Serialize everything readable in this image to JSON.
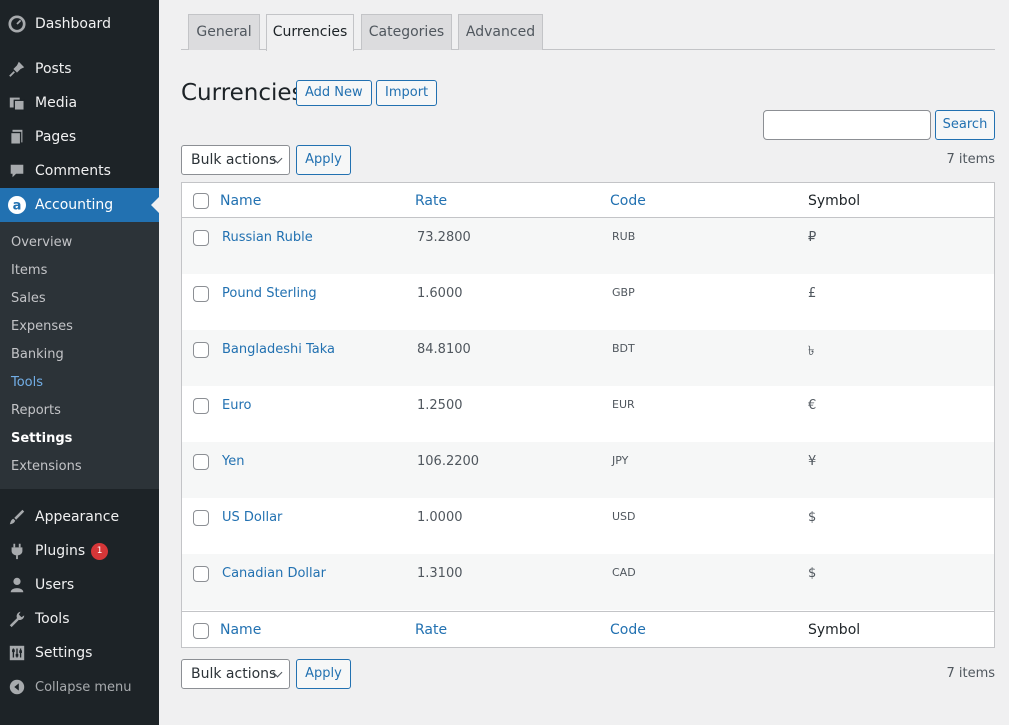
{
  "sidebar": {
    "top_items": [
      {
        "label": "Dashboard",
        "icon": "dashboard-icon"
      },
      {
        "label": "Posts",
        "icon": "pin-icon"
      },
      {
        "label": "Media",
        "icon": "media-icon"
      },
      {
        "label": "Pages",
        "icon": "pages-icon"
      },
      {
        "label": "Comments",
        "icon": "comments-icon"
      },
      {
        "label": "Accounting",
        "icon": "accounting-icon"
      }
    ],
    "submenu": [
      "Overview",
      "Items",
      "Sales",
      "Expenses",
      "Banking",
      "Tools",
      "Reports",
      "Settings",
      "Extensions"
    ],
    "bottom_items": [
      {
        "label": "Appearance",
        "icon": "brush-icon"
      },
      {
        "label": "Plugins",
        "icon": "plugin-icon",
        "badge": "1"
      },
      {
        "label": "Users",
        "icon": "user-icon"
      },
      {
        "label": "Tools",
        "icon": "wrench-icon"
      },
      {
        "label": "Settings",
        "icon": "settings-icon"
      }
    ],
    "collapse_label": "Collapse menu"
  },
  "tabs": [
    "General",
    "Currencies",
    "Categories",
    "Advanced"
  ],
  "page": {
    "title": "Currencies",
    "add_new": "Add New",
    "import": "Import",
    "search_button": "Search",
    "search_value": "",
    "bulk_actions": "Bulk actions",
    "apply": "Apply",
    "items_count": "7 items"
  },
  "table": {
    "columns": [
      "Name",
      "Rate",
      "Code",
      "Symbol"
    ],
    "rows": [
      {
        "name": "Russian Ruble",
        "rate": "73.2800",
        "code": "RUB",
        "symbol": "₽"
      },
      {
        "name": "Pound Sterling",
        "rate": "1.6000",
        "code": "GBP",
        "symbol": "£"
      },
      {
        "name": "Bangladeshi Taka",
        "rate": "84.8100",
        "code": "BDT",
        "symbol": "৳"
      },
      {
        "name": "Euro",
        "rate": "1.2500",
        "code": "EUR",
        "symbol": "€"
      },
      {
        "name": "Yen",
        "rate": "106.2200",
        "code": "JPY",
        "symbol": "¥"
      },
      {
        "name": "US Dollar",
        "rate": "1.0000",
        "code": "USD",
        "symbol": "$"
      },
      {
        "name": "Canadian Dollar",
        "rate": "1.3100",
        "code": "CAD",
        "symbol": "$"
      }
    ]
  },
  "colors": {
    "accent": "#2271b1",
    "sidebar_bg": "#1d2327",
    "badge": "#d63638"
  }
}
